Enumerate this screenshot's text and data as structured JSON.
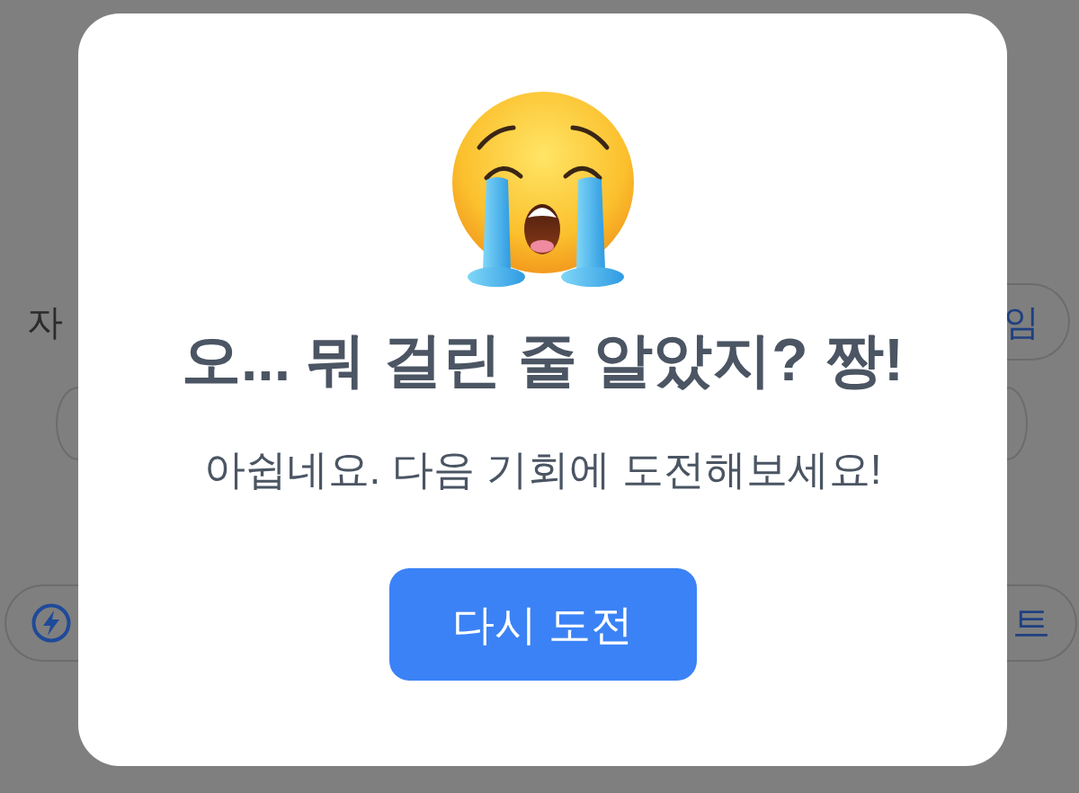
{
  "background": {
    "heading": "자",
    "heading_button": "임",
    "footer_button": "트"
  },
  "dialog": {
    "title": "오... 뭐 걸린 줄 알았지? 짱!",
    "message": "아쉽네요. 다음 기회에 도전해보세요!",
    "button": "다시 도전"
  }
}
